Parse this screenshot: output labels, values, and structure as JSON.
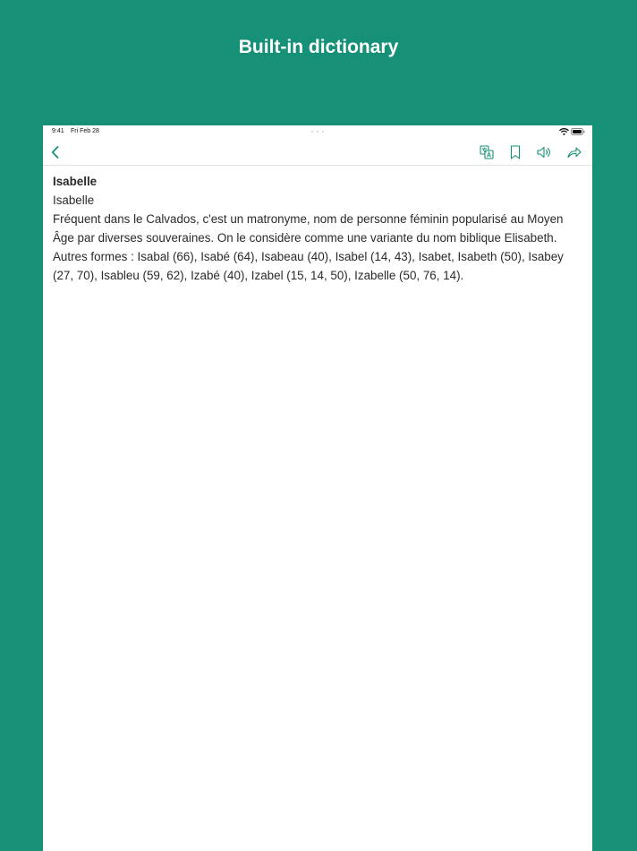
{
  "banner": {
    "title": "Built-in dictionary"
  },
  "status_bar": {
    "time": "9:41",
    "date": "Fri Feb 28"
  },
  "toolbar": {
    "accent_color": "#169077",
    "icons": [
      "back-chevron-icon",
      "translate-icon",
      "bookmark-icon",
      "speaker-icon",
      "share-icon"
    ]
  },
  "entry": {
    "headword": "Isabelle",
    "subheading": "Isabelle",
    "definition": "Fréquent dans le Calvados, c'est un matronyme, nom de personne féminin popularisé au Moyen Âge par diverses souveraines. On le considère comme une variante du nom biblique Elisabeth. Autres formes : Isabal (66), Isabé (64), Isabeau (40), Isabel (14, 43), Isabet, Isabeth (50), Isabey (27, 70), Isableu (59, 62), Izabé (40), Izabel (15, 14, 50), Izabelle (50, 76, 14)."
  },
  "colors": {
    "background": "#169077",
    "text": "#2a2a2a"
  }
}
